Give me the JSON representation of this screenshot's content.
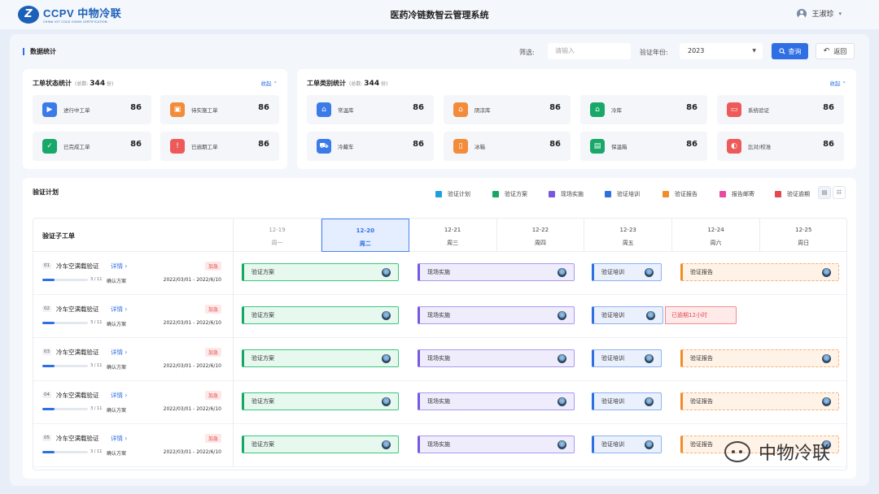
{
  "app": {
    "logo_text": "CCPV 中物冷联",
    "logo_sub": "CHINA IOT COLD CHAIN CERTIFICATION",
    "logo_mark": "Z",
    "title": "医药冷链数智云管理系统",
    "user": "王淑珍"
  },
  "filter": {
    "section_title": "数据统计",
    "label": "筛选:",
    "input_placeholder": "请输入",
    "year_label": "验证年份:",
    "year_value": "2023",
    "query_label": "查询",
    "back_label": "返回"
  },
  "status_stats": {
    "title": "工单状态统计",
    "total_prefix": "(总数:",
    "total": "344",
    "total_suffix": "份)",
    "collapse": "收起",
    "items": [
      {
        "label": "进行中工单",
        "value": "86",
        "color": "#3b7be8",
        "icon": "play-icon"
      },
      {
        "label": "待实施工单",
        "value": "86",
        "color": "#f28c3a",
        "icon": "box-icon"
      },
      {
        "label": "已完成工单",
        "value": "86",
        "color": "#18a86a",
        "icon": "check-icon"
      },
      {
        "label": "已逾期工单",
        "value": "86",
        "color": "#ee5a5a",
        "icon": "alert-icon"
      }
    ]
  },
  "type_stats": {
    "title": "工单类别统计",
    "total_prefix": "(总数:",
    "total": "344",
    "total_suffix": "份)",
    "collapse": "收起",
    "items": [
      {
        "label": "常温库",
        "value": "86",
        "color": "#3b7be8",
        "icon": "warehouse-icon"
      },
      {
        "label": "阴凉库",
        "value": "86",
        "color": "#f28c3a",
        "icon": "warehouse-icon"
      },
      {
        "label": "冷库",
        "value": "86",
        "color": "#18a86a",
        "icon": "warehouse-icon"
      },
      {
        "label": "系统验证",
        "value": "86",
        "color": "#ee5a5a",
        "icon": "monitor-icon"
      },
      {
        "label": "冷藏车",
        "value": "86",
        "color": "#3b7be8",
        "icon": "truck-icon"
      },
      {
        "label": "冰箱",
        "value": "86",
        "color": "#f28c3a",
        "icon": "fridge-icon"
      },
      {
        "label": "保温箱",
        "value": "86",
        "color": "#18a86a",
        "icon": "cooler-box-icon"
      },
      {
        "label": "比对/校准",
        "value": "86",
        "color": "#ee5a5a",
        "icon": "calibrate-icon"
      }
    ]
  },
  "plan": {
    "title": "验证计划",
    "legend": [
      {
        "label": "验证计划",
        "color": "#1ea0e0"
      },
      {
        "label": "验证方案",
        "color": "#16a765"
      },
      {
        "label": "现场实施",
        "color": "#7658e0"
      },
      {
        "label": "验证培训",
        "color": "#2f6fe4"
      },
      {
        "label": "验证报告",
        "color": "#f28c2a"
      },
      {
        "label": "报告邮寄",
        "color": "#e84aa0"
      },
      {
        "label": "验证逾期",
        "color": "#e5484d"
      }
    ],
    "left_header": "验证子工单",
    "days": [
      {
        "date": "12-19",
        "weekday": "周一"
      },
      {
        "date": "12-20",
        "weekday": "周二"
      },
      {
        "date": "12-21",
        "weekday": "周三"
      },
      {
        "date": "12-22",
        "weekday": "周四"
      },
      {
        "date": "12-23",
        "weekday": "周五"
      },
      {
        "date": "12-24",
        "weekday": "周六"
      },
      {
        "date": "12-25",
        "weekday": "周日"
      }
    ],
    "rows": [
      {
        "num": "01",
        "title": "冷车空满载验证",
        "detail": "详情 ›",
        "tag": "加急",
        "progress": "3 / 11",
        "progress_frac": 0.27,
        "stage": "确认方案",
        "period": "2022/03/01 - 2022/6/10",
        "t1": "验证方案",
        "t2": "现场实施",
        "t3": "验证培训",
        "t4": "验证报告",
        "late": ""
      },
      {
        "num": "02",
        "title": "冷车空满载验证",
        "detail": "详情 ›",
        "tag": "加急",
        "progress": "3 / 11",
        "progress_frac": 0.27,
        "stage": "确认方案",
        "period": "2022/03/01 - 2022/6/10",
        "t1": "验证方案",
        "t2": "现场实施",
        "t3": "验证培训",
        "t4": "",
        "late": "已逾期12小时"
      },
      {
        "num": "03",
        "title": "冷车空满载验证",
        "detail": "详情 ›",
        "tag": "加急",
        "progress": "3 / 11",
        "progress_frac": 0.27,
        "stage": "确认方案",
        "period": "2022/03/01 - 2022/6/10",
        "t1": "验证方案",
        "t2": "现场实施",
        "t3": "验证培训",
        "t4": "验证报告",
        "late": ""
      },
      {
        "num": "04",
        "title": "冷车空满载验证",
        "detail": "详情 ›",
        "tag": "加急",
        "progress": "3 / 11",
        "progress_frac": 0.27,
        "stage": "确认方案",
        "period": "2022/03/01 - 2022/6/10",
        "t1": "验证方案",
        "t2": "现场实施",
        "t3": "验证培训",
        "t4": "验证报告",
        "late": ""
      },
      {
        "num": "05",
        "title": "冷车空满载验证",
        "detail": "详情 ›",
        "tag": "加急",
        "progress": "3 / 11",
        "progress_frac": 0.27,
        "stage": "确认方案",
        "period": "2022/03/01 - 2022/6/10",
        "t1": "验证方案",
        "t2": "现场实施",
        "t3": "验证培训",
        "t4": "验证报告",
        "late": ""
      }
    ]
  },
  "watermark": "中物冷联"
}
